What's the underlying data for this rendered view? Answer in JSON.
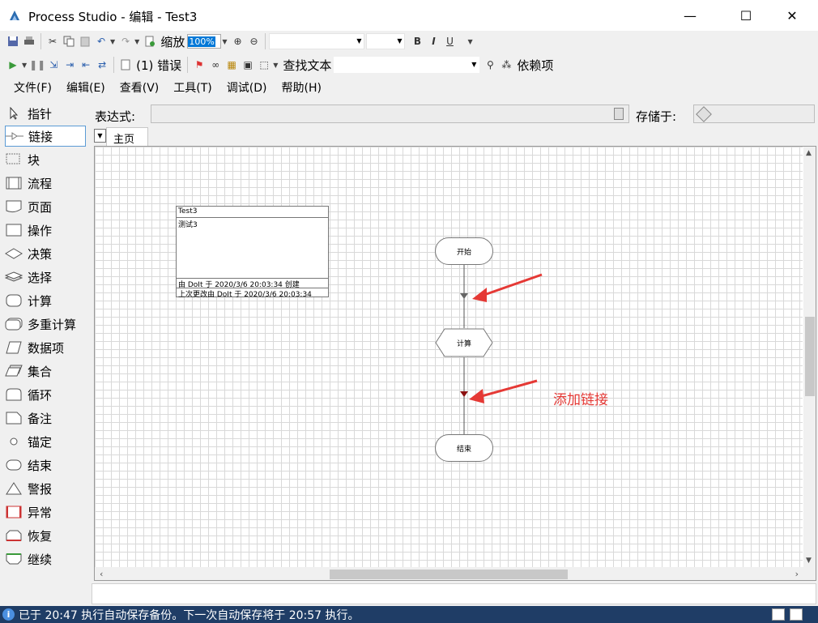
{
  "window": {
    "title": "Process Studio  - 编辑 - Test3",
    "minimize": "—",
    "maximize": "☐",
    "close": "✕"
  },
  "toolbar1": {
    "zoom_label": "缩放",
    "zoom_value": "100%",
    "bold": "B",
    "italic": "I",
    "underline": "U"
  },
  "toolbar2": {
    "errors_label": "(1) 错误",
    "find_label": "查找文本",
    "dependencies_label": "依赖项"
  },
  "menu": [
    "文件(F)",
    "编辑(E)",
    "查看(V)",
    "工具(T)",
    "调试(D)",
    "帮助(H)"
  ],
  "palette": [
    {
      "label": "指针",
      "icon": "pointer-icon"
    },
    {
      "label": "链接",
      "icon": "link-icon",
      "selected": true
    },
    {
      "label": "块",
      "icon": "block-icon"
    },
    {
      "label": "流程",
      "icon": "process-icon"
    },
    {
      "label": "页面",
      "icon": "page-icon"
    },
    {
      "label": "操作",
      "icon": "action-icon"
    },
    {
      "label": "决策",
      "icon": "decision-icon"
    },
    {
      "label": "选择",
      "icon": "choice-icon"
    },
    {
      "label": "计算",
      "icon": "calculation-icon"
    },
    {
      "label": "多重计算",
      "icon": "multi-calculation-icon"
    },
    {
      "label": "数据项",
      "icon": "data-item-icon"
    },
    {
      "label": "集合",
      "icon": "collection-icon"
    },
    {
      "label": "循环",
      "icon": "loop-icon"
    },
    {
      "label": "备注",
      "icon": "note-icon"
    },
    {
      "label": "锚定",
      "icon": "anchor-icon"
    },
    {
      "label": "结束",
      "icon": "end-icon"
    },
    {
      "label": "警报",
      "icon": "alert-icon"
    },
    {
      "label": "异常",
      "icon": "exception-icon"
    },
    {
      "label": "恢复",
      "icon": "recover-icon"
    },
    {
      "label": "继续",
      "icon": "resume-icon"
    }
  ],
  "expression": {
    "label": "表达式:",
    "store_label": "存储于:"
  },
  "tabs": {
    "main": "主页"
  },
  "info_box": {
    "title": "Test3",
    "description": "测试3",
    "created": "由 DoIt 于 2020/3/6  20:03:34  创建",
    "modified": "上次更改由 DoIt 于  2020/3/6 20:03:34"
  },
  "flow": {
    "start": "开始",
    "calc": "计算",
    "end": "结束"
  },
  "annotation": "添加链接",
  "colors": {
    "annotation_red": "#e53935",
    "status_bg": "#1f3d66",
    "link_arrow_dark": "#8b1010"
  },
  "status": {
    "text": "已于 20:47 执行自动保存备份。下一次自动保存将于 20:57 执行。"
  }
}
